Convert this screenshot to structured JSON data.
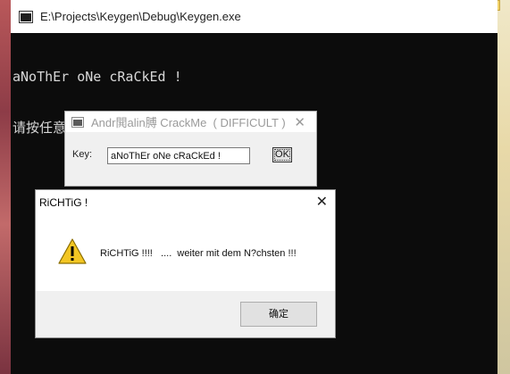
{
  "console": {
    "title": "E:\\Projects\\Keygen\\Debug\\Keygen.exe",
    "lines": [
      "aNoThEr oNe cRaCkEd !",
      "请按任意键继续. . ."
    ]
  },
  "crackme": {
    "title": "Andr閧alin膊 CrackMe  ( DIFFICULT )",
    "key_label": "Key:",
    "key_value": "aNoThEr oNe cRaCkEd !",
    "ok_label": "OK"
  },
  "messagebox": {
    "title": "RiCHTiG !",
    "message": "RiCHTiG !!!!   ....  weiter mit dem N?chsten !!!",
    "ok_label": "确定",
    "icon": "warning-icon"
  },
  "colors": {
    "console_bg": "#0c0c0c",
    "console_text": "#d8d8d8",
    "dialog_bg": "#f0f0f0",
    "warning_yellow": "#f3c623"
  }
}
